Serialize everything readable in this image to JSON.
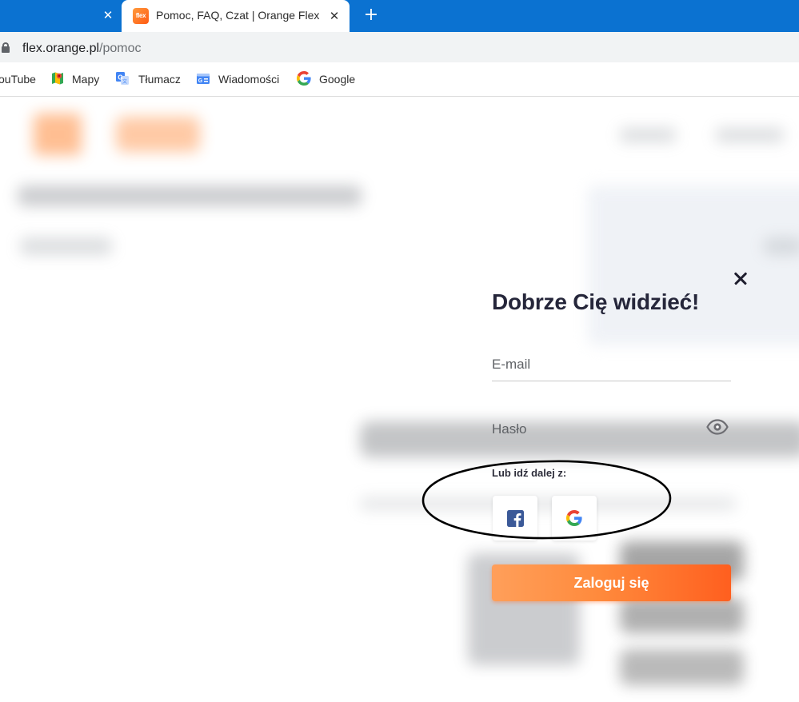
{
  "browser": {
    "active_tab": {
      "title": "Pomoc, FAQ, Czat | Orange Flex",
      "favicon_text": "flex"
    },
    "prev_tab_close": "✕",
    "tab_close": "✕",
    "new_tab": "+",
    "address": {
      "host": "flex.orange.pl",
      "path": "/pomoc"
    },
    "bookmarks": [
      {
        "label": "ouTube",
        "icon": "youtube-icon"
      },
      {
        "label": "Mapy",
        "icon": "maps-icon"
      },
      {
        "label": "Tłumacz",
        "icon": "translate-icon"
      },
      {
        "label": "Wiadomości",
        "icon": "news-icon"
      },
      {
        "label": "Google",
        "icon": "google-icon"
      }
    ]
  },
  "login": {
    "title": "Dobrze Cię widzieć!",
    "email_placeholder": "E-mail",
    "password_placeholder": "Hasło",
    "social_label": "Lub idź dalej z:",
    "social": [
      "facebook-icon",
      "google-icon"
    ],
    "submit_label": "Zaloguj się"
  },
  "colors": {
    "tabstrip": "#0b72d1",
    "brand_orange": "#ff7a2e",
    "facebook": "#3b5998"
  }
}
